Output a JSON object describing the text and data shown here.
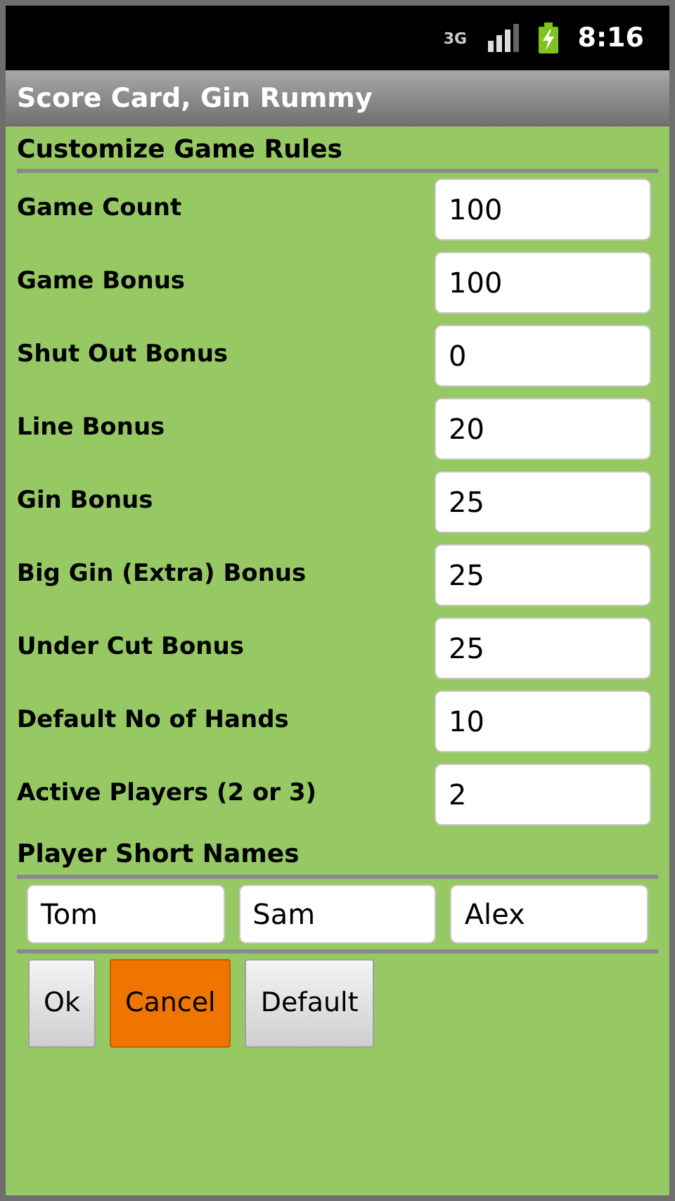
{
  "status_bar": {
    "network": "3G",
    "time": "8:16"
  },
  "window": {
    "title": "Score Card, Gin Rummy"
  },
  "rules_section": {
    "title": "Customize Game Rules",
    "rows": [
      {
        "label": "Game Count",
        "value": "100"
      },
      {
        "label": "Game Bonus",
        "value": "100"
      },
      {
        "label": "Shut Out Bonus",
        "value": "0"
      },
      {
        "label": "Line Bonus",
        "value": "20"
      },
      {
        "label": "Gin Bonus",
        "value": "25"
      },
      {
        "label": "Big Gin (Extra) Bonus",
        "value": "25"
      },
      {
        "label": "Under Cut Bonus",
        "value": "25"
      },
      {
        "label": "Default No of Hands",
        "value": "10"
      },
      {
        "label": "Active Players (2 or 3)",
        "value": "2"
      }
    ]
  },
  "players_section": {
    "title": "Player Short Names",
    "names": [
      "Tom",
      "Sam",
      "Alex"
    ]
  },
  "buttons": [
    {
      "label": "Ok",
      "selected": false
    },
    {
      "label": "Cancel",
      "selected": true
    },
    {
      "label": "Default",
      "selected": false
    }
  ]
}
